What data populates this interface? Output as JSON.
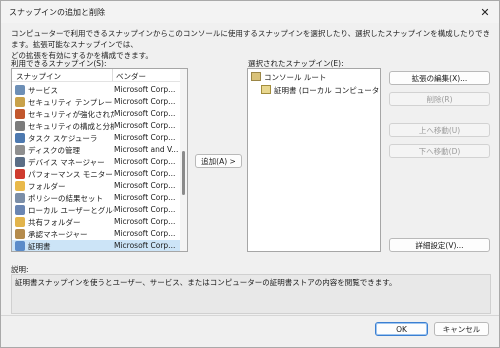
{
  "window": {
    "title": "スナップインの追加と削除",
    "close": "✕"
  },
  "description": [
    "コンピューターで利用できるスナップインからこのコンソールに使用するスナップインを選択したり、選択したスナップインを構成したりできます。拡張可能なスナップインでは、",
    "どの拡張を有効にするかを構成できます。"
  ],
  "available": {
    "label": "利用できるスナップイン(S):",
    "columns": [
      "スナップイン",
      "ベンダー"
    ],
    "rows": [
      {
        "name": "サービス",
        "vendor": "Microsoft Corp...",
        "icon": "gears-icon",
        "color": "#6d8fb6"
      },
      {
        "name": "セキュリティ テンプレート",
        "vendor": "Microsoft Corp...",
        "icon": "template-icon",
        "color": "#c9a24a"
      },
      {
        "name": "セキュリティが強化された...",
        "vendor": "Microsoft Corp...",
        "icon": "firewall-icon",
        "color": "#c2572d"
      },
      {
        "name": "セキュリティの構成と分析",
        "vendor": "Microsoft Corp...",
        "icon": "security-analysis-icon",
        "color": "#7c7c7c"
      },
      {
        "name": "タスク スケジューラ",
        "vendor": "Microsoft Corp...",
        "icon": "clock-icon",
        "color": "#4d79b0"
      },
      {
        "name": "ディスクの管理",
        "vendor": "Microsoft and V...",
        "icon": "disk-icon",
        "color": "#8f8f8f"
      },
      {
        "name": "デバイス マネージャー",
        "vendor": "Microsoft Corp...",
        "icon": "device-manager-icon",
        "color": "#5b6e86"
      },
      {
        "name": "パフォーマンス モニター",
        "vendor": "Microsoft Corp...",
        "icon": "no-entry-icon",
        "color": "#cf3b2e"
      },
      {
        "name": "フォルダー",
        "vendor": "Microsoft Corp...",
        "icon": "folder-icon",
        "color": "#e9b94a"
      },
      {
        "name": "ポリシーの結果セット",
        "vendor": "Microsoft Corp...",
        "icon": "policy-icon",
        "color": "#7b8ea8"
      },
      {
        "name": "ローカル ユーザーとグループ",
        "vendor": "Microsoft Corp...",
        "icon": "users-icon",
        "color": "#6a86b3"
      },
      {
        "name": "共有フォルダー",
        "vendor": "Microsoft Corp...",
        "icon": "shared-folder-icon",
        "color": "#e2b44c"
      },
      {
        "name": "承認マネージャー",
        "vendor": "Microsoft Corp...",
        "icon": "authorization-icon",
        "color": "#b58b4c"
      },
      {
        "name": "証明書",
        "vendor": "Microsoft Corp...",
        "icon": "certificate-icon",
        "color": "#5a8bc9",
        "selected": true
      }
    ]
  },
  "add_button": "追加(A) >",
  "selected": {
    "label": "選択されたスナップイン(E):",
    "nodes": [
      {
        "text": "コンソール ルート",
        "icon": "console-root-icon"
      },
      {
        "text": "証明書 (ローカル コンピューター)",
        "icon": "certificate-icon"
      }
    ]
  },
  "right_buttons": {
    "edit_extensions": "拡張の編集(X)...",
    "remove": "削除(R)",
    "move_up": "上へ移動(U)",
    "move_down": "下へ移動(D)",
    "advanced": "詳細設定(V)..."
  },
  "explanation": {
    "label": "説明:",
    "text": "証明書スナップインを使うとユーザー、サービス、またはコンピューターの証明書ストアの内容を閲覧できます。"
  },
  "footer": {
    "ok": "OK",
    "cancel": "キャンセル"
  }
}
